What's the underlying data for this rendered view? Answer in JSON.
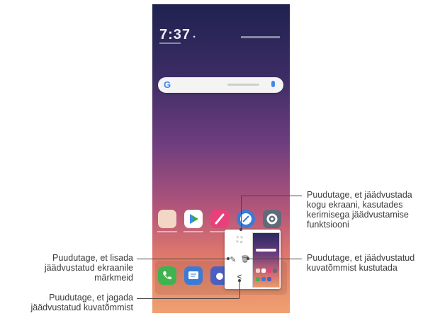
{
  "status": {
    "time": "7:37"
  },
  "search": {
    "logo": "G"
  },
  "popup": {
    "tools": [
      {
        "name": "extended-capture-icon",
        "glyph": "⛶"
      },
      {
        "name": "draw-icon",
        "glyph": "✎"
      },
      {
        "name": "delete-icon",
        "glyph": "🗑"
      },
      {
        "name": "share-icon",
        "glyph": "<"
      }
    ]
  },
  "callouts": {
    "capture_full": [
      "Puudutage, et jäädvustada",
      "kogu ekraani, kasutades",
      "kerimisega jäädvustamise",
      "funktsiooni"
    ],
    "add_marks": [
      "Puudutage, et lisada",
      "jäädvustatud ekraanile",
      "märkmeid"
    ],
    "delete": [
      "Puudutage, et jäädvustatud",
      "kuvatõmmist kustutada"
    ],
    "share": [
      "Puudutage, et jagada",
      "jäädvustatud kuvatõmmist"
    ]
  },
  "colors": {
    "google_blue": "#4285f4",
    "play_green": "#34a853",
    "settings_gray": "#5f6b7a"
  }
}
